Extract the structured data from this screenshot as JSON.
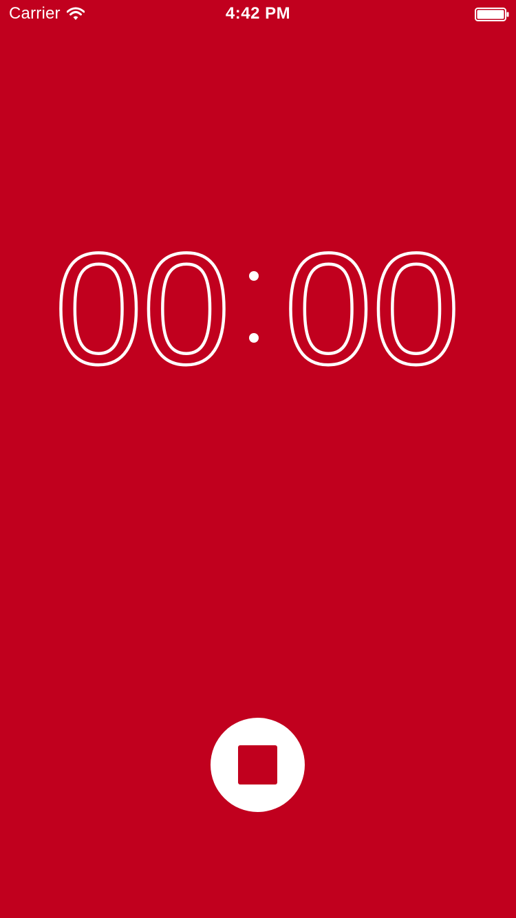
{
  "status_bar": {
    "carrier": "Carrier",
    "time": "4:42 PM",
    "wifi_icon": "wifi-icon",
    "battery_icon": "battery-full-icon"
  },
  "timer": {
    "minutes": "00",
    "seconds": "00",
    "separator": ":"
  },
  "controls": {
    "stop_icon": "stop-icon"
  },
  "colors": {
    "background": "#c1001e",
    "foreground": "#ffffff"
  }
}
